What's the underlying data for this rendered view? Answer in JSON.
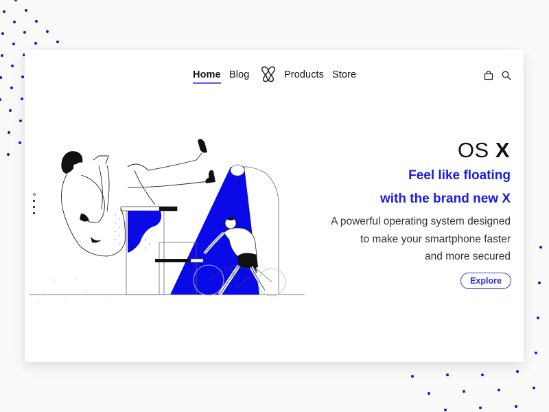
{
  "nav": {
    "items": [
      {
        "label": "Home",
        "active": true
      },
      {
        "label": "Blog",
        "active": false
      },
      {
        "label": "Products",
        "active": false
      },
      {
        "label": "Store",
        "active": false
      }
    ],
    "logo": "brand-x-logo",
    "icons": [
      "shopping-bag-icon",
      "search-icon"
    ]
  },
  "hero": {
    "title_light": "OS",
    "title_bold": "X",
    "tagline_1": "Feel like floating",
    "tagline_2": "with the brand new X",
    "desc_1": "A powerful operating system designed",
    "desc_2": "to make your smartphone faster",
    "desc_3": "and more secured",
    "cta_label": "Explore"
  },
  "pager": {
    "count": 4,
    "active_index": 0
  },
  "colors": {
    "accent": "#1a1ae6",
    "text": "#111111",
    "background": "#fafafa",
    "card": "#ffffff"
  }
}
